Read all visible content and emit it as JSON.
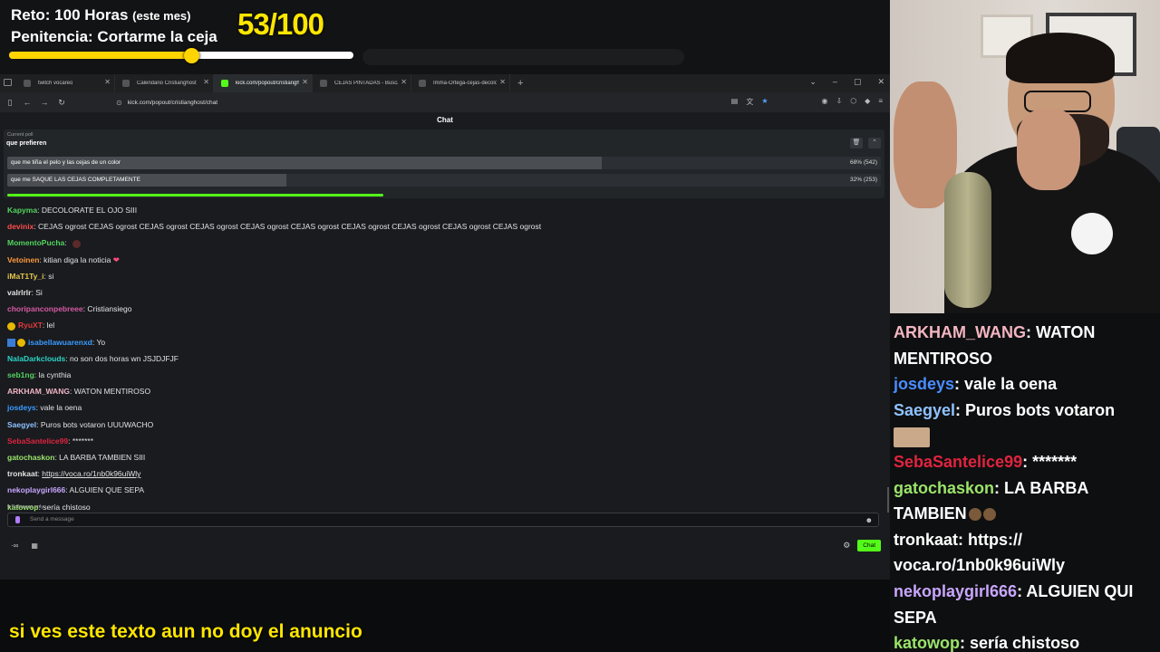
{
  "overlay": {
    "challenge_label": "Reto: 100 Horas",
    "challenge_note": "(este mes)",
    "penalty_label": "Penitencia: Cortarme la ceja",
    "score": "53/100",
    "progress_fraction": 0.53,
    "progress_color": "#ffd400"
  },
  "browser": {
    "tabs": [
      {
        "title": "twitch vocareo",
        "active": false
      },
      {
        "title": "Calendario Cristianghost",
        "active": false
      },
      {
        "title": "kick.com/popout/cristianghost/",
        "active": true
      },
      {
        "title": "CEJAS PINTADAS - Buscar con G",
        "active": false
      },
      {
        "title": "Imma-Ortega-cejas-decoloradas.jp",
        "active": false
      }
    ],
    "url": "kick.com/popout/cristianghost/chat"
  },
  "chat": {
    "header": "Chat",
    "poll": {
      "caption": "Current poll",
      "question": "que prefieren",
      "options": [
        {
          "label": "que me tiña el pelo y las cejas de un color",
          "pct_text": "68% (542)",
          "fraction": 0.68
        },
        {
          "label": "que me SAQUE LAS CEJAS COMPLETAMENTE",
          "pct_text": "32% (253)",
          "fraction": 0.32
        }
      ],
      "time_remaining_fraction": 0.43,
      "accent": "#53fc18"
    },
    "messages": [
      {
        "user": "Kapyma",
        "color": "#53d45e",
        "text": "DECOLORATE EL OJO SIII"
      },
      {
        "user": "devinix",
        "color": "#ff4c4c",
        "text": "CEJAS ogrost CEJAS ogrost CEJAS ogrost CEJAS ogrost CEJAS ogrost CEJAS ogrost CEJAS ogrost CEJAS ogrost CEJAS ogrost CEJAS ogrost"
      },
      {
        "user": "MomentoPucha",
        "color": "#53d45e",
        "text": ""
      },
      {
        "user": "Vetoinen",
        "color": "#ff9a3c",
        "text": "kitian diga la noticia"
      },
      {
        "user": "iMaT1Ty_i",
        "color": "#e6c84d",
        "text": "si"
      },
      {
        "user": "valrlrlr",
        "color": "#e2e2e2",
        "text": "Si"
      },
      {
        "user": "choripanconpebreee",
        "color": "#d65aa3",
        "text": "Cristiansiego"
      },
      {
        "user": "RyuXT",
        "color": "#e03b3b",
        "text": "lel"
      },
      {
        "user": "isabellawuarenxd",
        "color": "#3a9bff",
        "text": "Yo"
      },
      {
        "user": "NalaDarkclouds",
        "color": "#2bd5c8",
        "text": "no son dos horas wn JSJDJFJF"
      },
      {
        "user": "seb1ng",
        "color": "#53d45e",
        "text": "la cynthia"
      },
      {
        "user": "ARKHAM_WANG",
        "color": "#f1b6c4",
        "text": "WATON MENTIROSO"
      },
      {
        "user": "josdeys",
        "color": "#3a9bff",
        "text": "vale la oena"
      },
      {
        "user": "Saegyel",
        "color": "#8fc2ff",
        "text": "Puros bots votaron UUUWACHO"
      },
      {
        "user": "SebaSantelice99",
        "color": "#e0243f",
        "text": "*******"
      },
      {
        "user": "gatochaskon",
        "color": "#9be46b",
        "text": "LA BARBA TAMBIEN SIII"
      },
      {
        "user": "tronkaat",
        "color": "#e2e2e2",
        "text": "https://voca.ro/1nb0k96uiWly"
      },
      {
        "user": "nekoplaygirl666",
        "color": "#c9a6ff",
        "text": "ALGUIEN QUE SEPA"
      },
      {
        "user": "katowop",
        "color": "#9be46b",
        "text": "sería chistoso"
      }
    ],
    "followers_only": "Followers only",
    "send_placeholder": "Send a message",
    "chat_button": "Chat",
    "bottom_left_left": "·",
    "bottom_left_infinity": "∞"
  },
  "subtitle": "si ves este texto aun no doy el anuncio",
  "overlay_chat": [
    {
      "user": "ARKHAM_WANG",
      "color": "#f3b5c1",
      "text": "WATON"
    },
    {
      "user": "",
      "color": "#ffffff",
      "text": "MENTIROSO"
    },
    {
      "user": "josdeys",
      "color": "#4a8cff",
      "text": "vale la oena"
    },
    {
      "user": "Saegyel",
      "color": "#8fc2ff",
      "text": "Puros bots votaron"
    },
    {
      "user": "SebaSantelice99",
      "color": "#e0243f",
      "text": "*******"
    },
    {
      "user": "gatochaskon",
      "color": "#9be46b",
      "text": "LA BARBA"
    },
    {
      "user": "",
      "color": "#ffffff",
      "text": "TAMBIEN"
    },
    {
      "user": "tronkaat",
      "color": "#ffffff",
      "text": "https://"
    },
    {
      "user": "",
      "color": "#ffffff",
      "text": "voca.ro/1nb0k96uiWly"
    },
    {
      "user": "nekoplaygirl666",
      "color": "#c9a6ff",
      "text": "ALGUIEN QUI"
    },
    {
      "user": "",
      "color": "#ffffff",
      "text": "SEPA"
    },
    {
      "user": "katowop",
      "color": "#9be46b",
      "text": "sería chistoso"
    }
  ]
}
